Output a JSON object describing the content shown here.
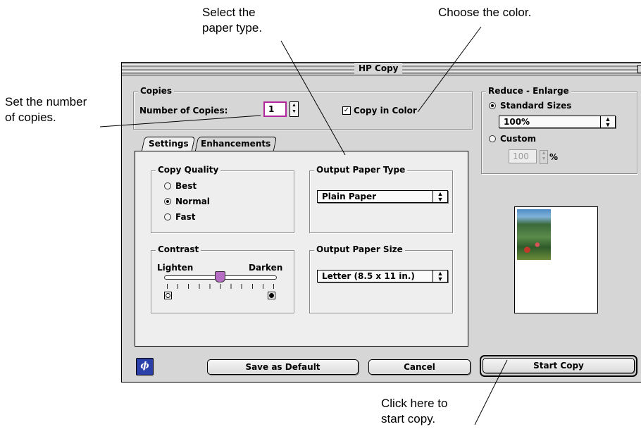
{
  "callouts": {
    "paper_type": "Select the\npaper type.",
    "color": "Choose the color.",
    "copies": "Set the number\nof copies.",
    "start": "Click here to\nstart copy."
  },
  "window": {
    "title": "HP Copy"
  },
  "copies": {
    "group_label": "Copies",
    "number_label": "Number of Copies:",
    "number_value": "1",
    "color_label": "Copy in Color",
    "color_checked": true
  },
  "reduce_enlarge": {
    "group_label": "Reduce - Enlarge",
    "standard_label": "Standard Sizes",
    "standard_value": "100%",
    "custom_label": "Custom",
    "custom_value": "100",
    "percent": "%"
  },
  "tabs": [
    {
      "label": "Settings",
      "active": true
    },
    {
      "label": "Enhancements",
      "active": false
    }
  ],
  "settings": {
    "quality": {
      "label": "Copy Quality",
      "options": [
        "Best",
        "Normal",
        "Fast"
      ],
      "selected": "Normal"
    },
    "paper_type": {
      "label": "Output Paper Type",
      "value": "Plain Paper"
    },
    "contrast": {
      "label": "Contrast",
      "lighten": "Lighten",
      "darken": "Darken",
      "level": 0.5
    },
    "paper_size": {
      "label": "Output Paper Size",
      "value": "Letter (8.5 x 11 in.)"
    }
  },
  "buttons": {
    "save_default": "Save as Default",
    "cancel": "Cancel",
    "start": "Start Copy"
  },
  "icons": {
    "hp_logo": "hp-logo-icon",
    "popup_arrows": "up-down-arrows-icon"
  }
}
